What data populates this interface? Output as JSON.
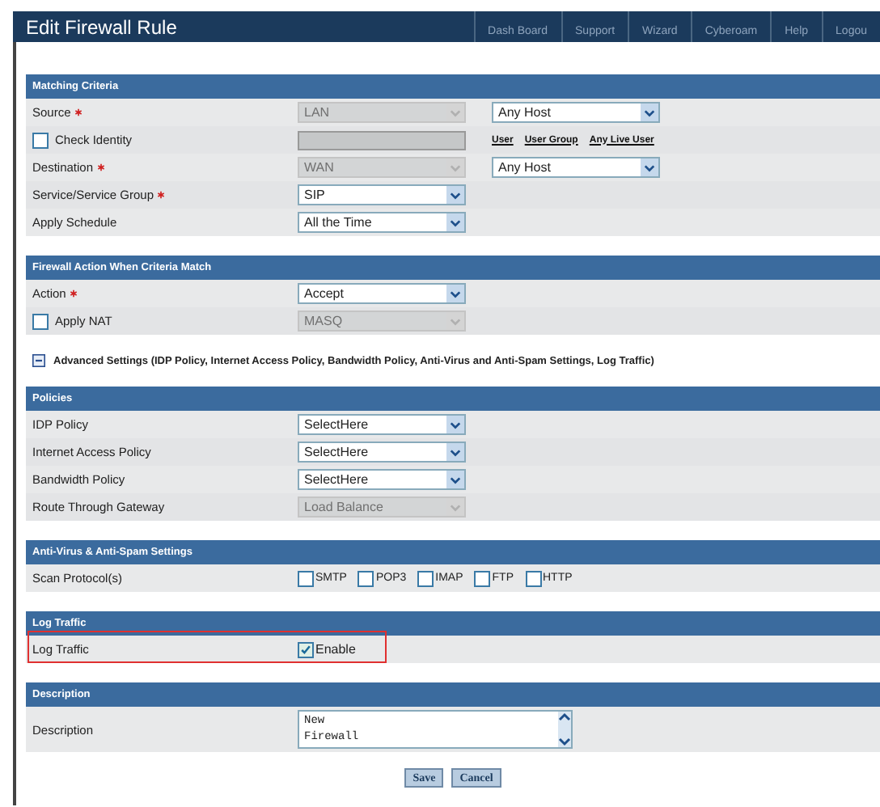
{
  "window": {
    "title": "Edit Firewall Rule"
  },
  "nav": [
    "Dash Board",
    "Support",
    "Wizard",
    "Cyberoam",
    "Help",
    "Logou"
  ],
  "sections": [
    {
      "kind": "group",
      "title": "Matching Criteria",
      "rows": [
        {
          "label": "Source",
          "required": true,
          "highlighted": false,
          "controls": [
            {
              "kind": "select",
              "value": "LAN",
              "disabled": true
            },
            {
              "kind": "select",
              "value": "Any Host",
              "disabled": false
            }
          ]
        },
        {
          "label": "Check Identity",
          "required": false,
          "highlighted": false,
          "label_checkbox": {
            "checked": false
          },
          "controls": [
            {
              "kind": "text",
              "disabled": true
            },
            {
              "kind": "links",
              "items": [
                "User",
                "User Group",
                "Any Live User"
              ]
            }
          ]
        },
        {
          "label": "Destination",
          "required": true,
          "highlighted": false,
          "controls": [
            {
              "kind": "select",
              "value": "WAN",
              "disabled": true
            },
            {
              "kind": "select",
              "value": "Any Host",
              "disabled": false
            }
          ]
        },
        {
          "label": "Service/Service Group",
          "required": true,
          "highlighted": false,
          "controls": [
            {
              "kind": "select",
              "value": "SIP",
              "disabled": false
            }
          ]
        },
        {
          "label": "Apply Schedule",
          "required": false,
          "highlighted": false,
          "controls": [
            {
              "kind": "select",
              "value": "All the Time",
              "disabled": false
            }
          ]
        }
      ]
    },
    {
      "kind": "group",
      "title": "Firewall Action When Criteria Match",
      "rows": [
        {
          "label": "Action",
          "required": true,
          "highlighted": false,
          "controls": [
            {
              "kind": "select",
              "value": "Accept",
              "disabled": false
            }
          ]
        },
        {
          "label": "Apply NAT",
          "required": false,
          "highlighted": false,
          "label_checkbox": {
            "checked": false
          },
          "controls": [
            {
              "kind": "select",
              "value": "MASQ",
              "disabled": true
            }
          ]
        }
      ]
    },
    {
      "kind": "toggle",
      "expanded": true,
      "text": "Advanced Settings (IDP Policy, Internet Access Policy, Bandwidth Policy, Anti-Virus and Anti-Spam Settings, Log Traffic)"
    },
    {
      "kind": "group",
      "title": "Policies",
      "rows": [
        {
          "label": "IDP Policy",
          "required": false,
          "highlighted": false,
          "controls": [
            {
              "kind": "select",
              "value": "SelectHere",
              "disabled": false
            }
          ]
        },
        {
          "label": "Internet Access Policy",
          "required": false,
          "highlighted": false,
          "controls": [
            {
              "kind": "select",
              "value": "SelectHere",
              "disabled": false
            }
          ]
        },
        {
          "label": "Bandwidth Policy",
          "required": false,
          "highlighted": false,
          "controls": [
            {
              "kind": "select",
              "value": "SelectHere",
              "disabled": false
            }
          ]
        },
        {
          "label": "Route Through Gateway",
          "required": false,
          "highlighted": false,
          "controls": [
            {
              "kind": "select",
              "value": "Load Balance",
              "disabled": true
            }
          ]
        }
      ]
    },
    {
      "kind": "group",
      "title": "Anti-Virus & Anti-Spam Settings",
      "rows": [
        {
          "label": "Scan Protocol(s)",
          "required": false,
          "highlighted": false,
          "controls": [
            {
              "kind": "checks",
              "items": [
                {
                  "label": "SMTP",
                  "checked": false
                },
                {
                  "label": "POP3",
                  "checked": false
                },
                {
                  "label": "IMAP",
                  "checked": false
                },
                {
                  "label": "FTP",
                  "checked": false
                },
                {
                  "label": "HTTP",
                  "checked": false
                }
              ]
            }
          ]
        }
      ]
    },
    {
      "kind": "group",
      "title": "Log Traffic",
      "rows": [
        {
          "label": "Log Traffic",
          "required": false,
          "highlighted": true,
          "controls": [
            {
              "kind": "checks",
              "items": [
                {
                  "label": "Enable",
                  "checked": true
                }
              ]
            }
          ]
        }
      ]
    },
    {
      "kind": "group",
      "title": "Description",
      "rows": [
        {
          "label": "Description",
          "required": false,
          "highlighted": false,
          "controls": [
            {
              "kind": "textarea",
              "value": "New\nFirewall"
            }
          ]
        }
      ]
    }
  ],
  "buttons": [
    "Save",
    "Cancel"
  ]
}
